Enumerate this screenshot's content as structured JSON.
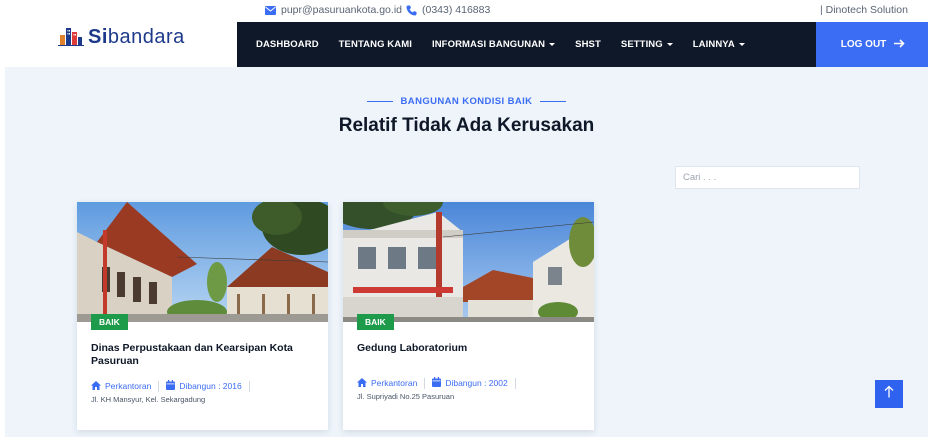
{
  "topbar": {
    "email": "pupr@pasuruankota.go.id",
    "phone": "(0343) 416883",
    "credit": "| Dinotech Solution"
  },
  "header": {
    "logo_prefix": "Si",
    "logo_suffix": "bandara",
    "nav": [
      {
        "label": "DASHBOARD",
        "dropdown": false
      },
      {
        "label": "TENTANG KAMI",
        "dropdown": false
      },
      {
        "label": "INFORMASI BANGUNAN",
        "dropdown": true
      },
      {
        "label": "SHST",
        "dropdown": false
      },
      {
        "label": "SETTING",
        "dropdown": true
      },
      {
        "label": "LAINNYA",
        "dropdown": true
      }
    ],
    "logout_label": "LOG OUT"
  },
  "section": {
    "eyebrow": "BANGUNAN KONDISI BAIK",
    "title": "Relatif Tidak Ada Kerusakan"
  },
  "search": {
    "placeholder": "Cari . . ."
  },
  "cards": [
    {
      "badge": "BAIK",
      "title": "Dinas Perpustakaan dan Kearsipan Kota Pasuruan",
      "category": "Perkantoran",
      "built": "Dibangun : 2016",
      "address": "Jl. KH Mansyur, Kel. Sekargadung"
    },
    {
      "badge": "BAIK",
      "title": "Gedung Laboratorium",
      "category": "Perkantoran",
      "built": "Dibangun : 2002",
      "address": "Jl. Supriyadi No.25 Pasuruan"
    }
  ],
  "colors": {
    "navy": "#0f1828",
    "accent": "#3b6cf4",
    "badge_green": "#1d9a4a",
    "section_bg": "#eef4fa"
  }
}
